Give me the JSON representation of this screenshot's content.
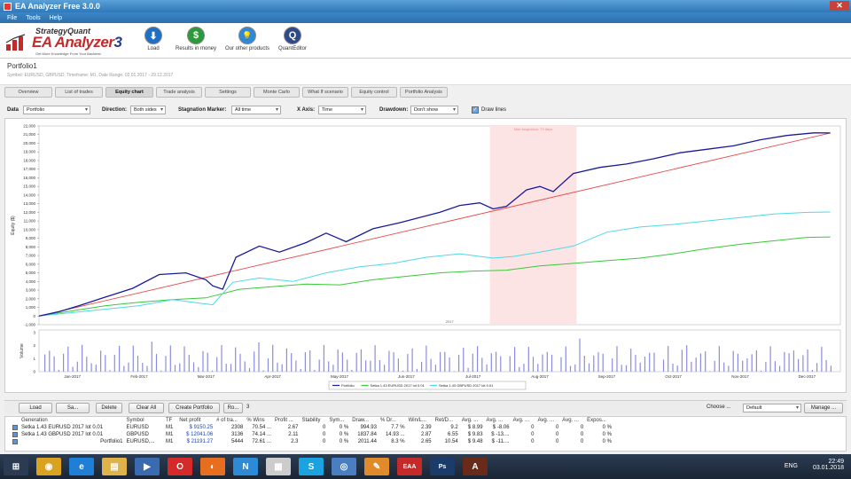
{
  "window": {
    "title": "EA Analyzer Free 3.0.0",
    "close_glyph": "✕"
  },
  "menu": [
    "File",
    "Tools",
    "Help"
  ],
  "logo": {
    "brand": "StrategyQuant",
    "product": "EA Analyzer",
    "version": "3",
    "tagline": "Get More Knowledge From Your Backtest"
  },
  "toolbar": [
    {
      "label": "Load",
      "icon": "download-icon",
      "glyph": "⬇",
      "color": "#1e6fc6"
    },
    {
      "label": "Results in money",
      "icon": "dollar-icon",
      "glyph": "$",
      "color": "#2a9a3a"
    },
    {
      "label": "Our other products",
      "icon": "lightbulb-icon",
      "glyph": "💡",
      "color": "#2f88d8"
    },
    {
      "label": "QuantEditor",
      "icon": "quanteditor-icon",
      "glyph": "Q",
      "color": "#2d4a8a"
    }
  ],
  "portfolio": {
    "title": "Portfolio1",
    "subtitle": "Symbol: EURUSD, GBPUSD, Timeframe: M1, Date Range: 02.01.2017 - 29.12.2017"
  },
  "tabs": [
    {
      "label": "Overview",
      "active": false
    },
    {
      "label": "List of trades",
      "active": false
    },
    {
      "label": "Equity chart",
      "active": true
    },
    {
      "label": "Trade analysis",
      "active": false
    },
    {
      "label": "Settings",
      "active": false
    },
    {
      "label": "Monte Carlo",
      "active": false
    },
    {
      "label": "What If scenario",
      "active": false
    },
    {
      "label": "Equity control",
      "active": false
    },
    {
      "label": "Portfolio Analysis",
      "active": false
    }
  ],
  "controls": {
    "data_label": "Data",
    "data_value": "Portfolio",
    "direction_label": "Direction:",
    "direction_value": "Both sides",
    "stagnation_label": "Stagnation Marker:",
    "stagnation_value": "All time",
    "xaxis_label": "X Axis:",
    "xaxis_value": "Time",
    "drawdown_label": "Drawdown:",
    "drawdown_value": "Don't show",
    "drawlines_label": "Draw lines",
    "drawlines_checked": "✓"
  },
  "chart_data": {
    "type": "line",
    "ylabel": "Equity ($)",
    "volume_label": "Volume",
    "year_label": "2017",
    "stagnation_label": "Max stagnation: 79 days",
    "ylim": [
      -1000,
      22000
    ],
    "yticks": [
      -1000,
      0,
      1000,
      2000,
      3000,
      4000,
      5000,
      6000,
      7000,
      8000,
      9000,
      10000,
      11000,
      12000,
      13000,
      14000,
      15000,
      16000,
      17000,
      18000,
      19000,
      20000,
      21000,
      22000
    ],
    "ytick_labels": [
      "-1,000",
      "0",
      "1,000",
      "2,000",
      "3,000",
      "4,000",
      "5,000",
      "6,000",
      "7,000",
      "8,000",
      "9,000",
      "10,000",
      "11,000",
      "12,000",
      "13,000",
      "14,000",
      "15,000",
      "16,000",
      "17,000",
      "18,000",
      "19,000",
      "20,000",
      "21,000",
      "22,000"
    ],
    "vol_ticks": [
      "3",
      "2",
      "1",
      "0"
    ],
    "months": [
      "Jan-2017",
      "Feb-2017",
      "Mar-2017",
      "Apr-2017",
      "May-2017",
      "Jun-2017",
      "Jul-2017",
      "Aug-2017",
      "Sep-2017",
      "Oct-2017",
      "Nov-2017",
      "Dec-2017"
    ],
    "stagnation_range": [
      6.75,
      8.05
    ],
    "series": [
      {
        "name": "Portfolio",
        "color": "#1a1a9a",
        "x": [
          0,
          0.3,
          0.6,
          1,
          1.4,
          1.8,
          2.2,
          2.5,
          2.6,
          2.75,
          2.95,
          3.3,
          3.6,
          4.0,
          4.3,
          4.6,
          5.0,
          5.4,
          5.8,
          6.0,
          6.3,
          6.6,
          6.8,
          7.0,
          7.3,
          7.5,
          7.7,
          8.0,
          8.4,
          8.8,
          9.2,
          9.6,
          10.0,
          10.4,
          10.8,
          11.2,
          11.6,
          11.85
        ],
        "y": [
          0,
          500,
          1200,
          2200,
          3200,
          4800,
          5000,
          4200,
          3500,
          3100,
          6800,
          8100,
          7400,
          8500,
          9600,
          8600,
          10100,
          10800,
          11600,
          12000,
          12800,
          13100,
          12400,
          12700,
          14600,
          15000,
          14400,
          16500,
          17200,
          17600,
          18200,
          18900,
          19300,
          19700,
          20400,
          20900,
          21200,
          21191
        ]
      },
      {
        "name": "Setka 1.43 EURUSD 2017 lot 0.01",
        "color": "#39c939",
        "x": [
          0,
          0.5,
          1,
          1.5,
          2,
          2.5,
          3,
          3.5,
          4,
          4.5,
          5,
          5.5,
          6,
          6.5,
          7,
          7.5,
          8,
          8.5,
          9,
          9.5,
          10,
          10.5,
          11,
          11.5,
          11.85
        ],
        "y": [
          0,
          600,
          1200,
          1600,
          1900,
          2100,
          3100,
          3400,
          3700,
          3600,
          4200,
          4600,
          5000,
          5200,
          5300,
          5800,
          6100,
          6400,
          6700,
          7200,
          7800,
          8300,
          8700,
          9100,
          9150
        ]
      },
      {
        "name": "Setka 1.43 GBPUSD 2017 lot 0.01",
        "color": "#4fd8e8",
        "x": [
          0,
          0.5,
          1,
          1.5,
          2,
          2.4,
          2.6,
          2.9,
          3.3,
          3.8,
          4.3,
          4.8,
          5.3,
          5.8,
          6.3,
          6.8,
          7.1,
          7.5,
          8.0,
          8.5,
          9.0,
          9.5,
          10.0,
          10.5,
          11.0,
          11.5,
          11.85
        ],
        "y": [
          0,
          400,
          800,
          1200,
          1900,
          1500,
          1300,
          3900,
          4400,
          4000,
          5000,
          5700,
          6100,
          6800,
          7200,
          6700,
          6900,
          7400,
          8100,
          9700,
          10300,
          10600,
          11000,
          11400,
          11800,
          12000,
          12041
        ]
      }
    ],
    "trend": {
      "color": "#e84a4a",
      "from": [
        0,
        0
      ],
      "to": [
        11.85,
        21191
      ]
    }
  },
  "bottom_toolbar": {
    "load": "Load",
    "save": "Sa...",
    "delete": "Delete",
    "clear_all": "Clear All",
    "create_portfolio": "Create Portfolio",
    "ro": "Ro...",
    "count": "3",
    "choose_label": "Choose ...",
    "choose_value": "Default",
    "manage": "Manage ..."
  },
  "results": {
    "headers": [
      "Generation",
      "Symbol",
      "TF",
      "Net profit",
      "# of tra...",
      "% Wins",
      "Profit ...",
      "Stability",
      "Sym...",
      "Draw...",
      "% Dr...",
      "Win/L...",
      "Ret/D...",
      "Avg. ...",
      "Avg. ...",
      "Avg. ...",
      "Avg. ...",
      "Avg. ...",
      "Expos..."
    ],
    "rows": [
      [
        "Setka 1.43 EURUSD 2017 lot 0.01",
        "EURUSD",
        "M1",
        "$ 9150.25",
        "2308",
        "70.54 ...",
        "2.67",
        "0",
        "0 %",
        "994.93",
        "7.7 %",
        "2.39",
        "9.2",
        "$ 8.99",
        "$ -8.06",
        "0",
        "0",
        "0",
        "0 %"
      ],
      [
        "Setka 1.43 GBPUSD 2017 lot 0.01",
        "GBPUSD",
        "M1",
        "$ 12041.06",
        "3136",
        "74.14 ...",
        "2.11",
        "0",
        "0 %",
        "1837.84",
        "14.93 ...",
        "2.87",
        "6.55",
        "$ 9.83",
        "$ -13....",
        "0",
        "0",
        "0",
        "0 %"
      ],
      [
        "Portfolio1",
        "EURUSD,...",
        "M1",
        "$ 21191.27",
        "5444",
        "72.61 ...",
        "2.3",
        "0",
        "0 %",
        "2011.44",
        "8.3 %",
        "2.65",
        "10.54",
        "$ 9.48",
        "$ -11....",
        "0",
        "0",
        "0",
        "0 %"
      ]
    ]
  },
  "taskbar": {
    "time": "22:49",
    "date": "03.01.2018",
    "lang": "ENG",
    "apps": [
      {
        "name": "start-icon",
        "glyph": "⊞",
        "color": "#2b3c52"
      },
      {
        "name": "chrome-icon",
        "glyph": "◉",
        "color": "#d9a321"
      },
      {
        "name": "ie-icon",
        "glyph": "e",
        "color": "#1f7ed6"
      },
      {
        "name": "explorer-icon",
        "glyph": "▤",
        "color": "#e0b34a"
      },
      {
        "name": "media-icon",
        "glyph": "▶",
        "color": "#3a6ab0"
      },
      {
        "name": "opera-icon",
        "glyph": "O",
        "color": "#d42a2a"
      },
      {
        "name": "firefox-icon",
        "glyph": "◐",
        "color": "#e86e1f"
      },
      {
        "name": "n-app-icon",
        "glyph": "N",
        "color": "#2c8ad6"
      },
      {
        "name": "pdf-icon",
        "glyph": "▦",
        "color": "#ccc"
      },
      {
        "name": "skype-icon",
        "glyph": "S",
        "color": "#1aa3e0"
      },
      {
        "name": "globe-icon",
        "glyph": "◎",
        "color": "#4a7ec0"
      },
      {
        "name": "paint-icon",
        "glyph": "✎",
        "color": "#e08a2a"
      },
      {
        "name": "eaa-icon",
        "glyph": "EAA",
        "color": "#c42a2a"
      },
      {
        "name": "ps-icon",
        "glyph": "Ps",
        "color": "#1b3b6a"
      },
      {
        "name": "ai-icon",
        "glyph": "A",
        "color": "#6a2a1a"
      }
    ]
  }
}
